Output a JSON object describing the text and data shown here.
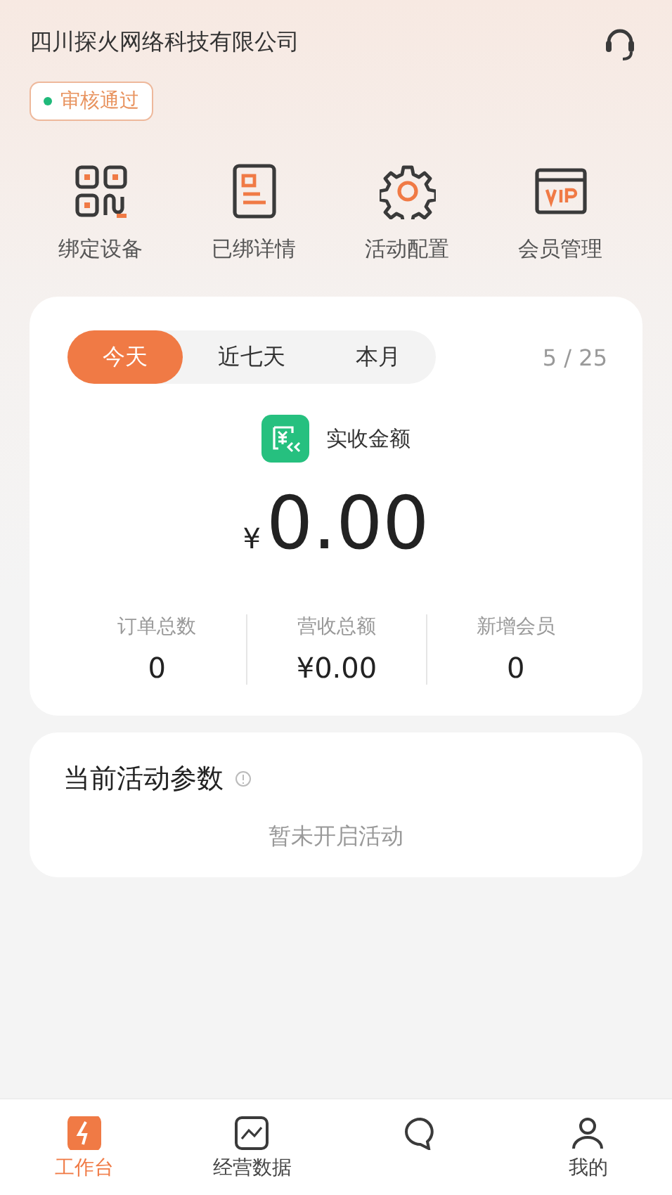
{
  "header": {
    "company": "四川探火网络科技有限公司",
    "status_badge": {
      "label": "审核通过",
      "color": "#1fb97a"
    }
  },
  "shortcuts": [
    {
      "kind": "qr",
      "label": "绑定设备"
    },
    {
      "kind": "doc",
      "label": "已绑详情"
    },
    {
      "kind": "gear",
      "label": "活动配置"
    },
    {
      "kind": "vip",
      "label": "会员管理"
    }
  ],
  "stats_card": {
    "periods": [
      {
        "label": "今天",
        "selected": true
      },
      {
        "label": "近七天",
        "selected": false
      },
      {
        "label": "本月",
        "selected": false
      }
    ],
    "date": "5 / 25",
    "amount_label": "实收金额",
    "currency": "¥",
    "amount": "0.00",
    "metrics": [
      {
        "label": "订单总数",
        "value": "0"
      },
      {
        "label": "营收总额",
        "value": "¥0.00"
      },
      {
        "label": "新增会员",
        "value": "0"
      }
    ]
  },
  "activity_card": {
    "title": "当前活动参数",
    "empty_text": "暂未开启活动"
  },
  "tab_bar": [
    {
      "kind": "bolt",
      "label": "工作台",
      "selected": true
    },
    {
      "kind": "chart",
      "label": "经营数据",
      "selected": false
    },
    {
      "kind": "chat",
      "selected": false
    },
    {
      "kind": "person",
      "label": "我的",
      "selected": false
    }
  ]
}
